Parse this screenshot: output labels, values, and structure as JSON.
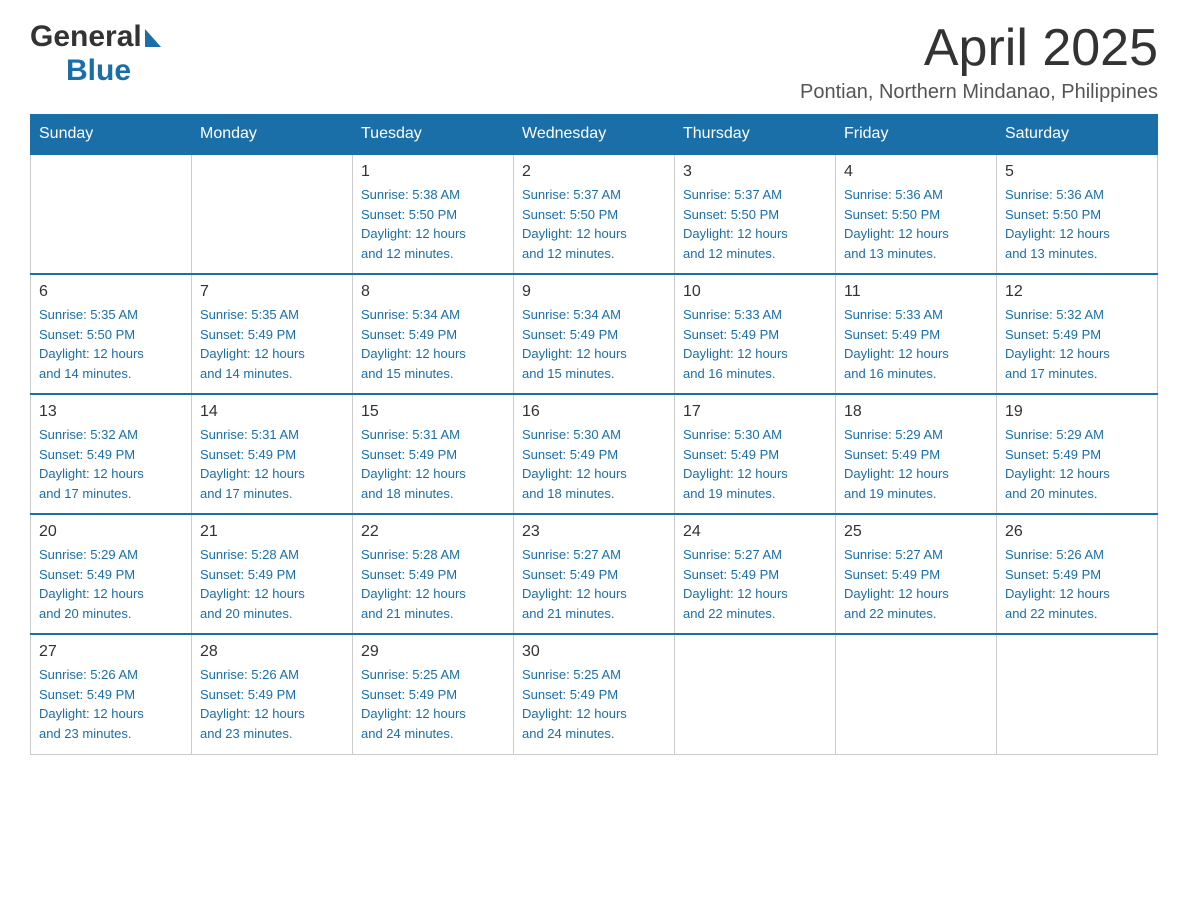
{
  "header": {
    "month_year": "April 2025",
    "location": "Pontian, Northern Mindanao, Philippines",
    "logo_general": "General",
    "logo_blue": "Blue"
  },
  "weekdays": [
    "Sunday",
    "Monday",
    "Tuesday",
    "Wednesday",
    "Thursday",
    "Friday",
    "Saturday"
  ],
  "weeks": [
    [
      {
        "day": "",
        "info": ""
      },
      {
        "day": "",
        "info": ""
      },
      {
        "day": "1",
        "info": "Sunrise: 5:38 AM\nSunset: 5:50 PM\nDaylight: 12 hours\nand 12 minutes."
      },
      {
        "day": "2",
        "info": "Sunrise: 5:37 AM\nSunset: 5:50 PM\nDaylight: 12 hours\nand 12 minutes."
      },
      {
        "day": "3",
        "info": "Sunrise: 5:37 AM\nSunset: 5:50 PM\nDaylight: 12 hours\nand 12 minutes."
      },
      {
        "day": "4",
        "info": "Sunrise: 5:36 AM\nSunset: 5:50 PM\nDaylight: 12 hours\nand 13 minutes."
      },
      {
        "day": "5",
        "info": "Sunrise: 5:36 AM\nSunset: 5:50 PM\nDaylight: 12 hours\nand 13 minutes."
      }
    ],
    [
      {
        "day": "6",
        "info": "Sunrise: 5:35 AM\nSunset: 5:50 PM\nDaylight: 12 hours\nand 14 minutes."
      },
      {
        "day": "7",
        "info": "Sunrise: 5:35 AM\nSunset: 5:49 PM\nDaylight: 12 hours\nand 14 minutes."
      },
      {
        "day": "8",
        "info": "Sunrise: 5:34 AM\nSunset: 5:49 PM\nDaylight: 12 hours\nand 15 minutes."
      },
      {
        "day": "9",
        "info": "Sunrise: 5:34 AM\nSunset: 5:49 PM\nDaylight: 12 hours\nand 15 minutes."
      },
      {
        "day": "10",
        "info": "Sunrise: 5:33 AM\nSunset: 5:49 PM\nDaylight: 12 hours\nand 16 minutes."
      },
      {
        "day": "11",
        "info": "Sunrise: 5:33 AM\nSunset: 5:49 PM\nDaylight: 12 hours\nand 16 minutes."
      },
      {
        "day": "12",
        "info": "Sunrise: 5:32 AM\nSunset: 5:49 PM\nDaylight: 12 hours\nand 17 minutes."
      }
    ],
    [
      {
        "day": "13",
        "info": "Sunrise: 5:32 AM\nSunset: 5:49 PM\nDaylight: 12 hours\nand 17 minutes."
      },
      {
        "day": "14",
        "info": "Sunrise: 5:31 AM\nSunset: 5:49 PM\nDaylight: 12 hours\nand 17 minutes."
      },
      {
        "day": "15",
        "info": "Sunrise: 5:31 AM\nSunset: 5:49 PM\nDaylight: 12 hours\nand 18 minutes."
      },
      {
        "day": "16",
        "info": "Sunrise: 5:30 AM\nSunset: 5:49 PM\nDaylight: 12 hours\nand 18 minutes."
      },
      {
        "day": "17",
        "info": "Sunrise: 5:30 AM\nSunset: 5:49 PM\nDaylight: 12 hours\nand 19 minutes."
      },
      {
        "day": "18",
        "info": "Sunrise: 5:29 AM\nSunset: 5:49 PM\nDaylight: 12 hours\nand 19 minutes."
      },
      {
        "day": "19",
        "info": "Sunrise: 5:29 AM\nSunset: 5:49 PM\nDaylight: 12 hours\nand 20 minutes."
      }
    ],
    [
      {
        "day": "20",
        "info": "Sunrise: 5:29 AM\nSunset: 5:49 PM\nDaylight: 12 hours\nand 20 minutes."
      },
      {
        "day": "21",
        "info": "Sunrise: 5:28 AM\nSunset: 5:49 PM\nDaylight: 12 hours\nand 20 minutes."
      },
      {
        "day": "22",
        "info": "Sunrise: 5:28 AM\nSunset: 5:49 PM\nDaylight: 12 hours\nand 21 minutes."
      },
      {
        "day": "23",
        "info": "Sunrise: 5:27 AM\nSunset: 5:49 PM\nDaylight: 12 hours\nand 21 minutes."
      },
      {
        "day": "24",
        "info": "Sunrise: 5:27 AM\nSunset: 5:49 PM\nDaylight: 12 hours\nand 22 minutes."
      },
      {
        "day": "25",
        "info": "Sunrise: 5:27 AM\nSunset: 5:49 PM\nDaylight: 12 hours\nand 22 minutes."
      },
      {
        "day": "26",
        "info": "Sunrise: 5:26 AM\nSunset: 5:49 PM\nDaylight: 12 hours\nand 22 minutes."
      }
    ],
    [
      {
        "day": "27",
        "info": "Sunrise: 5:26 AM\nSunset: 5:49 PM\nDaylight: 12 hours\nand 23 minutes."
      },
      {
        "day": "28",
        "info": "Sunrise: 5:26 AM\nSunset: 5:49 PM\nDaylight: 12 hours\nand 23 minutes."
      },
      {
        "day": "29",
        "info": "Sunrise: 5:25 AM\nSunset: 5:49 PM\nDaylight: 12 hours\nand 24 minutes."
      },
      {
        "day": "30",
        "info": "Sunrise: 5:25 AM\nSunset: 5:49 PM\nDaylight: 12 hours\nand 24 minutes."
      },
      {
        "day": "",
        "info": ""
      },
      {
        "day": "",
        "info": ""
      },
      {
        "day": "",
        "info": ""
      }
    ]
  ]
}
